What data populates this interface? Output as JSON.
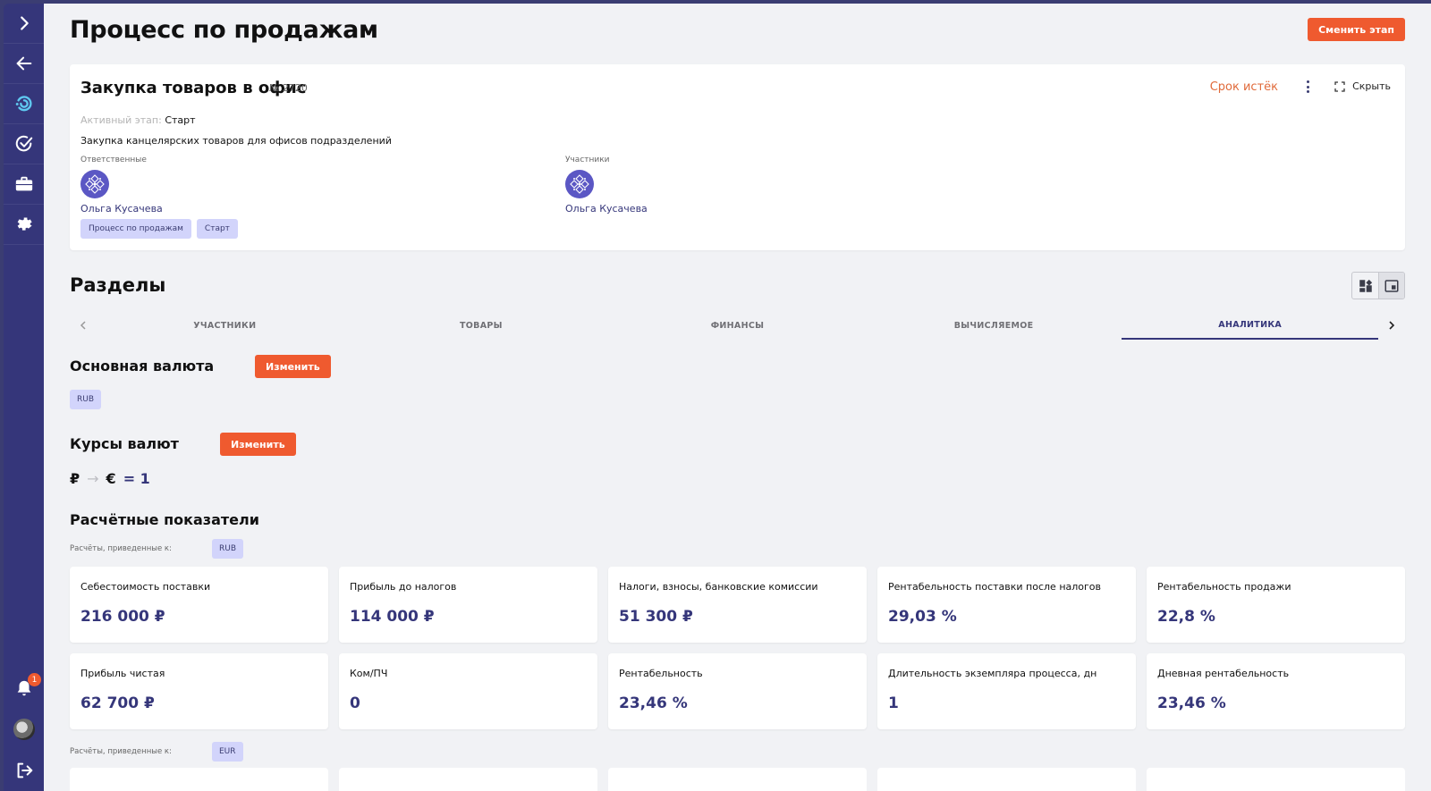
{
  "page": {
    "title": "Процесс по продажам",
    "change_stage_label": "Сменить этап"
  },
  "card": {
    "title": "Закупка товаров в офис",
    "number": "№ 2720",
    "deadline": "Срок истёк",
    "hide_label": "Скрыть",
    "active_stage_label": "Активный этап:",
    "active_stage_value": "Старт",
    "description": "Закупка канцелярских товаров для офисов подразделений",
    "responsible_label": "Ответственные",
    "responsible_name": "Ольга Кусачева",
    "participants_label": "Участники",
    "participant_name": "Ольга Кусачева",
    "tags": [
      "Процесс по продажам",
      "Старт"
    ]
  },
  "sections": {
    "title": "Разделы",
    "tabs": [
      "УЧАСТНИКИ",
      "ТОВАРЫ",
      "ФИНАНСЫ",
      "ВЫЧИСЛЯЕМОЕ",
      "АНАЛИТИКА"
    ],
    "active_tab": "АНАЛИТИКА"
  },
  "currency": {
    "title": "Основная валюта",
    "change_label": "Изменить",
    "value": "RUB"
  },
  "rates": {
    "title": "Курсы валют",
    "change_label": "Изменить",
    "from": "₽",
    "arrow": "→",
    "to": "€",
    "value": "= 1"
  },
  "metrics": {
    "title": "Расчётные показатели",
    "calc_label": "Расчёты, приведенные к:",
    "calc_currency_1": "RUB",
    "calc_currency_2": "EUR",
    "items": [
      {
        "label": "Себестоимость поставки",
        "value": "216 000 ₽"
      },
      {
        "label": "Прибыль до налогов",
        "value": "114 000 ₽"
      },
      {
        "label": "Налоги, взносы, банковские комиссии",
        "value": "51 300 ₽"
      },
      {
        "label": "Рентабельность поставки после налогов",
        "value": "29,03 %"
      },
      {
        "label": "Рентабельность продажи",
        "value": "22,8 %"
      },
      {
        "label": "Прибыль чистая",
        "value": "62 700 ₽"
      },
      {
        "label": "Ком/ПЧ",
        "value": "0"
      },
      {
        "label": "Рентабельность",
        "value": "23,46 %"
      },
      {
        "label": "Длительность экземпляра процесса, дн",
        "value": "1"
      },
      {
        "label": "Дневная рентабельность",
        "value": "23,46 %"
      }
    ]
  },
  "sidebar": {
    "notifications_count": "1"
  },
  "colors": {
    "accent": "#35367a",
    "orange": "#ef5a2f",
    "chip": "#d2d4fb"
  }
}
